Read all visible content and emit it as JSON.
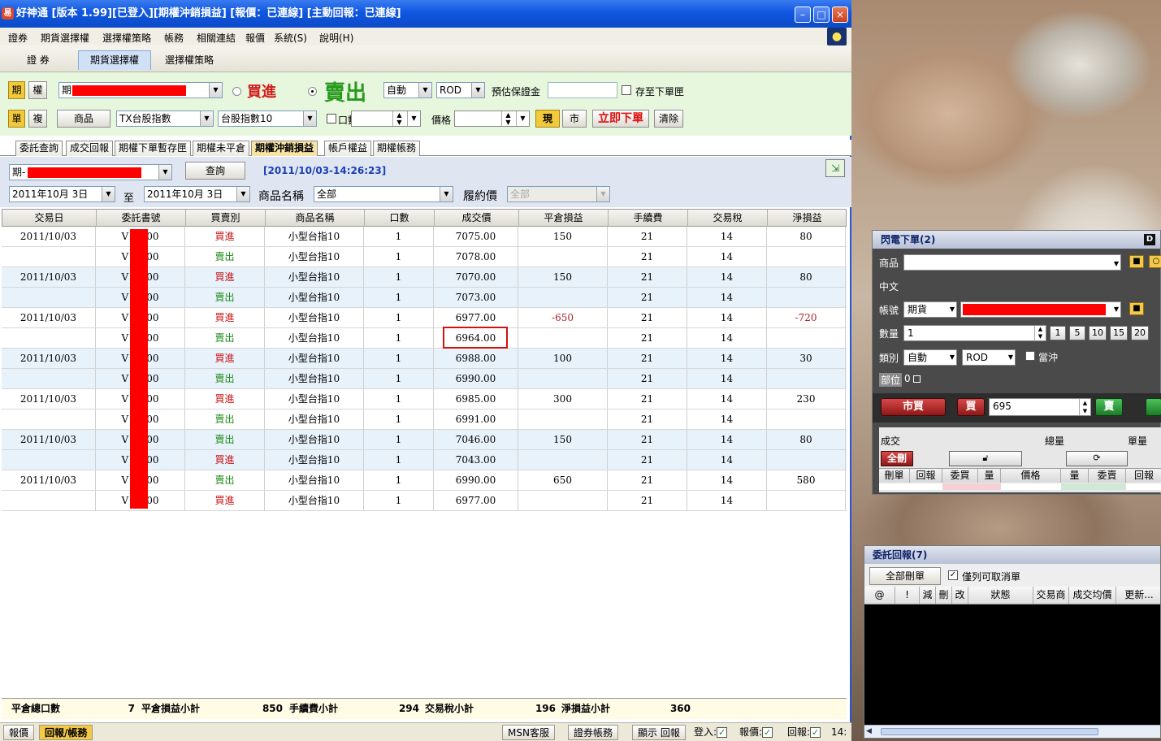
{
  "window": {
    "title": "好神通 [版本 1.99][已登入][期權沖銷損益] [報價：已連線] [主動回報：已連線]",
    "icon_label": "易",
    "controls": {
      "minimize": "–",
      "maximize": "□",
      "close": "×"
    }
  },
  "menu": [
    "證券",
    "期貨選擇權",
    "選擇權策略",
    "帳務",
    "相關連結",
    "報價",
    "系統(S)",
    "說明(H)"
  ],
  "top_tabs": [
    {
      "label": "證 券",
      "active": false
    },
    {
      "label": "期貨選擇權",
      "active": true
    },
    {
      "label": "選擇權策略",
      "active": false
    }
  ],
  "order_panel": {
    "mode_future": "期",
    "mode_option": "權",
    "account_prefix": "期",
    "buy_label": "買進",
    "sell_label": "賣出",
    "order_type": "自動",
    "tif": "ROD",
    "margin_label": "預估保證金",
    "save_label": "存至下單匣",
    "single": "單",
    "combo": "複",
    "product_button": "商品",
    "product_select": "TX台股指數",
    "contract_select": "台股指數10",
    "qty_label": "口數",
    "price_label": "價格",
    "limit_btn": "現",
    "market_btn": "市",
    "submit_btn": "立即下單",
    "clear_btn": "清除"
  },
  "sub_tabs": [
    {
      "label": "委託查詢",
      "active": false
    },
    {
      "label": "成交回報",
      "active": false
    },
    {
      "label": "期權下單暫存匣",
      "active": false
    },
    {
      "label": "期權未平倉",
      "active": false
    },
    {
      "label": "期權沖銷損益",
      "active": true
    },
    {
      "label": "帳戶權益",
      "active": false
    },
    {
      "label": "期權帳務",
      "active": false
    }
  ],
  "query": {
    "account_prefix": "期-",
    "query_button": "查詢",
    "timestamp": "[2011/10/03-14:26:23]",
    "date_from": "2011年10月 3日",
    "to_label": "至",
    "date_to": "2011年10月 3日",
    "product_name_label": "商品名稱",
    "product_name_value": "全部",
    "strike_label": "履約價",
    "strike_value": "全部"
  },
  "table": {
    "headers": [
      "交易日",
      "委託書號",
      "買賣別",
      "商品名稱",
      "口數",
      "成交價",
      "平倉損益",
      "手續費",
      "交易稅",
      "淨損益"
    ],
    "rows": [
      {
        "date": "2011/10/03",
        "order": "V",
        "order_tail": "00",
        "side": "買進",
        "product": "小型台指10",
        "qty": "1",
        "price": "7075.00",
        "pnl": "150",
        "fee": "21",
        "tax": "14",
        "net": "80"
      },
      {
        "date": "",
        "order": "V",
        "order_tail": "00",
        "side": "賣出",
        "product": "小型台指10",
        "qty": "1",
        "price": "7078.00",
        "pnl": "",
        "fee": "21",
        "tax": "14",
        "net": ""
      },
      {
        "date": "2011/10/03",
        "order": "V",
        "order_tail": "00",
        "side": "買進",
        "product": "小型台指10",
        "qty": "1",
        "price": "7070.00",
        "pnl": "150",
        "fee": "21",
        "tax": "14",
        "net": "80"
      },
      {
        "date": "",
        "order": "V",
        "order_tail": "00",
        "side": "賣出",
        "product": "小型台指10",
        "qty": "1",
        "price": "7073.00",
        "pnl": "",
        "fee": "21",
        "tax": "14",
        "net": ""
      },
      {
        "date": "2011/10/03",
        "order": "V",
        "order_tail": "00",
        "side": "買進",
        "product": "小型台指10",
        "qty": "1",
        "price": "6977.00",
        "pnl": "-650",
        "fee": "21",
        "tax": "14",
        "net": "-720"
      },
      {
        "date": "",
        "order": "V",
        "order_tail": "00",
        "side": "賣出",
        "product": "小型台指10",
        "qty": "1",
        "price": "6964.00",
        "pnl": "",
        "fee": "21",
        "tax": "14",
        "net": ""
      },
      {
        "date": "2011/10/03",
        "order": "V",
        "order_tail": "00",
        "side": "買進",
        "product": "小型台指10",
        "qty": "1",
        "price": "6988.00",
        "pnl": "100",
        "fee": "21",
        "tax": "14",
        "net": "30"
      },
      {
        "date": "",
        "order": "V",
        "order_tail": "00",
        "side": "賣出",
        "product": "小型台指10",
        "qty": "1",
        "price": "6990.00",
        "pnl": "",
        "fee": "21",
        "tax": "14",
        "net": ""
      },
      {
        "date": "2011/10/03",
        "order": "V",
        "order_tail": "00",
        "side": "買進",
        "product": "小型台指10",
        "qty": "1",
        "price": "6985.00",
        "pnl": "300",
        "fee": "21",
        "tax": "14",
        "net": "230"
      },
      {
        "date": "",
        "order": "V",
        "order_tail": "00",
        "side": "賣出",
        "product": "小型台指10",
        "qty": "1",
        "price": "6991.00",
        "pnl": "",
        "fee": "21",
        "tax": "14",
        "net": ""
      },
      {
        "date": "2011/10/03",
        "order": "V",
        "order_tail": "00",
        "side": "賣出",
        "product": "小型台指10",
        "qty": "1",
        "price": "7046.00",
        "pnl": "150",
        "fee": "21",
        "tax": "14",
        "net": "80"
      },
      {
        "date": "",
        "order": "V",
        "order_tail": "00",
        "side": "買進",
        "product": "小型台指10",
        "qty": "1",
        "price": "7043.00",
        "pnl": "",
        "fee": "21",
        "tax": "14",
        "net": ""
      },
      {
        "date": "2011/10/03",
        "order": "V",
        "order_tail": "00",
        "side": "賣出",
        "product": "小型台指10",
        "qty": "1",
        "price": "6990.00",
        "pnl": "650",
        "fee": "21",
        "tax": "14",
        "net": "580"
      },
      {
        "date": "",
        "order": "V",
        "order_tail": "00",
        "side": "買進",
        "product": "小型台指10",
        "qty": "1",
        "price": "6977.00",
        "pnl": "",
        "fee": "21",
        "tax": "14",
        "net": ""
      }
    ]
  },
  "summary": {
    "total_qty_label": "平倉總口數",
    "total_qty": "7",
    "pnl_label": "平倉損益小計",
    "pnl": "850",
    "fee_label": "手續費小計",
    "fee": "294",
    "tax_label": "交易稅小計",
    "tax": "196",
    "net_label": "淨損益小計",
    "net": "360"
  },
  "statusbar": {
    "tab_quote": "報價",
    "tab_report": "回報/帳務",
    "msn": "MSN客服",
    "stock_account": "證券帳務",
    "show_report": "顯示 回報",
    "login_label": "登入:",
    "quote_label": "報價:",
    "report_label": "回報:",
    "check": "✓",
    "clock": "14:"
  },
  "flash_order": {
    "title": "閃電下單(2)",
    "title_badge": "D",
    "product_label": "商品",
    "chinese_label": "中文",
    "account_label": "帳號",
    "account_type": "期貨",
    "qty_label": "數量",
    "qty_value": "1",
    "qty_presets": [
      "1",
      "5",
      "10",
      "15",
      "20"
    ],
    "type_label": "類別",
    "type_value": "自動",
    "tif_value": "ROD",
    "daytrade_label": "當沖",
    "position_label": "部位",
    "position_value": "0",
    "market_buy": "市買",
    "buy": "買",
    "price_value": "695",
    "sell": "賣",
    "deal_label": "成交",
    "total_qty_label": "總量",
    "single_qty_label": "單量",
    "delete_all": "全刪",
    "deal_cols": [
      "刪單",
      "回報",
      "委買",
      "量",
      "價格",
      "量",
      "委賣",
      "回報"
    ]
  },
  "order_report": {
    "title": "委託回報(7)",
    "delete_all": "全部刪單",
    "only_cancelable": "僅列可取消單",
    "cols": [
      "@",
      "!",
      "減",
      "刪",
      "改",
      "狀態",
      "交易商",
      "成交均價",
      "更新..."
    ]
  }
}
